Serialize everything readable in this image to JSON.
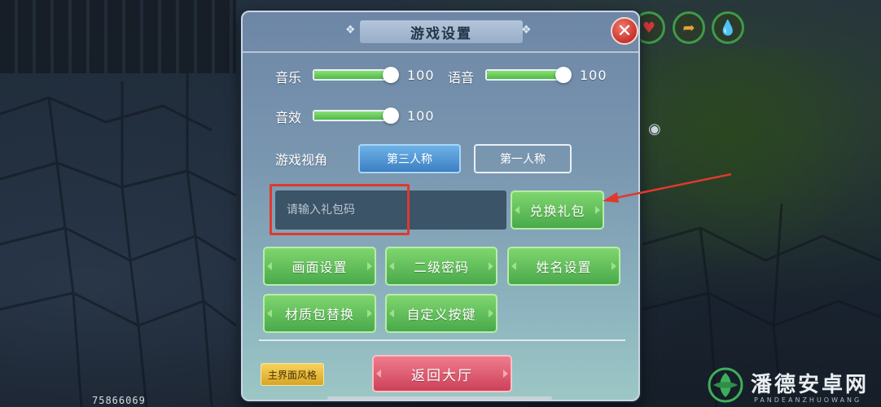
{
  "dialog": {
    "title": "游戏设置",
    "close_icon": "close-x-icon"
  },
  "audio": {
    "music_label": "音乐",
    "music_value": "100",
    "voice_label": "语音",
    "voice_value": "100",
    "sfx_label": "音效",
    "sfx_value": "100",
    "music_level": 1.0,
    "voice_level": 1.0,
    "sfx_level": 1.0
  },
  "camera": {
    "label": "游戏视角",
    "options": [
      "第三人称",
      "第一人称"
    ],
    "selected": "第三人称"
  },
  "gift": {
    "placeholder": "请输入礼包码",
    "redeem_label": "兑换礼包"
  },
  "buttons": {
    "graphics": "画面设置",
    "secondary_password": "二级密码",
    "name_settings": "姓名设置",
    "texture_pack": "材质包替换",
    "custom_keys": "自定义按键"
  },
  "footer": {
    "style_label": "主界面风格",
    "lobby_label": "返回大厅"
  },
  "hud": {
    "player_id": "75866069",
    "icons": [
      "heart-icon",
      "food-icon",
      "water-drop-icon",
      "eye-icon"
    ]
  },
  "watermark": {
    "name": "潘德安卓网",
    "sub": "PANDEANZHUOWANG"
  },
  "colors": {
    "accent_green": "#4fb94a",
    "accent_blue": "#3d7fc2",
    "accent_red": "#cd4159",
    "highlight_red": "#e0392f"
  }
}
